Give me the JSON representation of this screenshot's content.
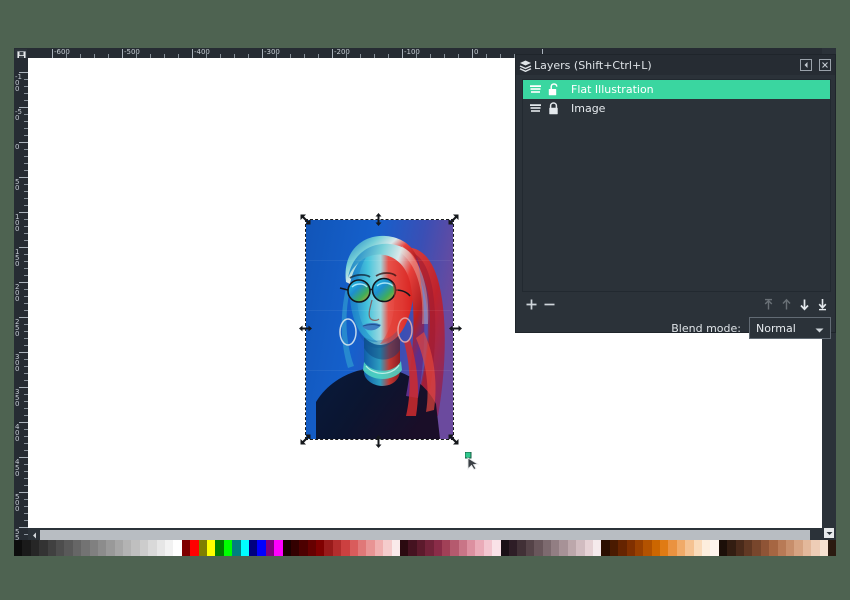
{
  "app": {
    "background_color": "#4e6351",
    "chrome_color": "#2b3239"
  },
  "canvas": {
    "corner_lock_icon": "lock-icon",
    "horizontal_ruler": {
      "labels": [
        "-600",
        "-500",
        "-400",
        "-300",
        "-200",
        "-100",
        "0"
      ],
      "unit_step": 100
    },
    "vertical_ruler": {
      "labels": [
        "-100",
        "-50",
        "0",
        "50",
        "100",
        "150",
        "200",
        "250",
        "300",
        "350",
        "400",
        "450",
        "500",
        "550"
      ],
      "unit_step": 50
    },
    "page_background": "#ffffff",
    "selection": {
      "handles": [
        "top-left",
        "top-center",
        "top-right",
        "middle-left",
        "middle-right",
        "bottom-left",
        "bottom-center",
        "bottom-right"
      ],
      "border_style": "dashed"
    },
    "cursor_icon": "resize-diagonal-cursor"
  },
  "scrollbars": {
    "vertical_arrow_icon": "chevron-down-icon",
    "horizontal_arrow_icon": "chevron-left-icon"
  },
  "layers_panel": {
    "title": "Layers (Shift+Ctrl+L)",
    "title_icon": "layers-icon",
    "titlebar_buttons": [
      {
        "name": "collapse-dock-button",
        "icon": "chevron-left-box-icon"
      },
      {
        "name": "close-dock-button",
        "icon": "close-box-icon"
      }
    ],
    "layers": [
      {
        "name": "Flat Illustration",
        "selected": true,
        "visibility_icon": "layer-visible-icon",
        "lock_icon": "unlocked-icon",
        "locked": false
      },
      {
        "name": "Image",
        "selected": false,
        "visibility_icon": "layer-visible-icon",
        "lock_icon": "locked-icon",
        "locked": true
      }
    ],
    "selected_highlight_color": "#3ad6a0",
    "toolbar_buttons": [
      {
        "name": "add-layer-button",
        "icon": "plus-icon",
        "enabled": true
      },
      {
        "name": "remove-layer-button",
        "icon": "minus-icon",
        "enabled": true
      },
      {
        "name": "raise-to-top-button",
        "icon": "arrow-up-to-top-icon",
        "enabled": false
      },
      {
        "name": "raise-layer-button",
        "icon": "arrow-up-icon",
        "enabled": false
      },
      {
        "name": "lower-layer-button",
        "icon": "arrow-down-icon",
        "enabled": true
      },
      {
        "name": "lower-to-bottom-button",
        "icon": "arrow-down-to-bottom-icon",
        "enabled": true
      }
    ],
    "blend_mode": {
      "label": "Blend mode:",
      "value": "Normal",
      "caret_icon": "chevron-down-icon"
    }
  },
  "palette": {
    "colors": [
      "#0d0d0d",
      "#1a1a1a",
      "#262626",
      "#333333",
      "#404040",
      "#4d4d4d",
      "#595959",
      "#666666",
      "#737373",
      "#808080",
      "#8c8c8c",
      "#999999",
      "#a6a6a6",
      "#b3b3b3",
      "#bfbfbf",
      "#cccccc",
      "#d9d9d9",
      "#e6e6e6",
      "#f2f2f2",
      "#ffffff",
      "#7f0000",
      "#ff0000",
      "#7f7f00",
      "#ffff00",
      "#007f00",
      "#00ff00",
      "#007f7f",
      "#00ffff",
      "#00007f",
      "#0000ff",
      "#7f007f",
      "#ff00ff",
      "#1a0000",
      "#330000",
      "#4d0000",
      "#660000",
      "#800000",
      "#991a1a",
      "#b32d2d",
      "#cc4040",
      "#d95c5c",
      "#e07878",
      "#e89494",
      "#f0b0b0",
      "#f5cccc",
      "#faeaea",
      "#2b0a10",
      "#451220",
      "#5c1a2c",
      "#73233a",
      "#8a2c48",
      "#a14057",
      "#b55a6e",
      "#c97587",
      "#dc90a0",
      "#eaabb8",
      "#f3c6d0",
      "#fae2e8",
      "#1a1016",
      "#2e1d26",
      "#413036",
      "#554348",
      "#69565b",
      "#7d6a6f",
      "#927e83",
      "#a79297",
      "#bca7ab",
      "#d1bcc0",
      "#e6d2d5",
      "#f5eaec",
      "#2b0f00",
      "#4a1a00",
      "#662400",
      "#803000",
      "#994000",
      "#b35200",
      "#cc6600",
      "#e07b14",
      "#ea9240",
      "#f0aa68",
      "#f5c291",
      "#fadbba",
      "#fdeedd",
      "#fff6ee",
      "#1c0f08",
      "#331d11",
      "#4a2a1a",
      "#613823",
      "#78462c",
      "#8f5436",
      "#a66642",
      "#b87a56",
      "#c78e6b",
      "#d6a382",
      "#e3b89b",
      "#eecdb6",
      "#f7e2d2",
      "#2b1a10"
    ]
  }
}
